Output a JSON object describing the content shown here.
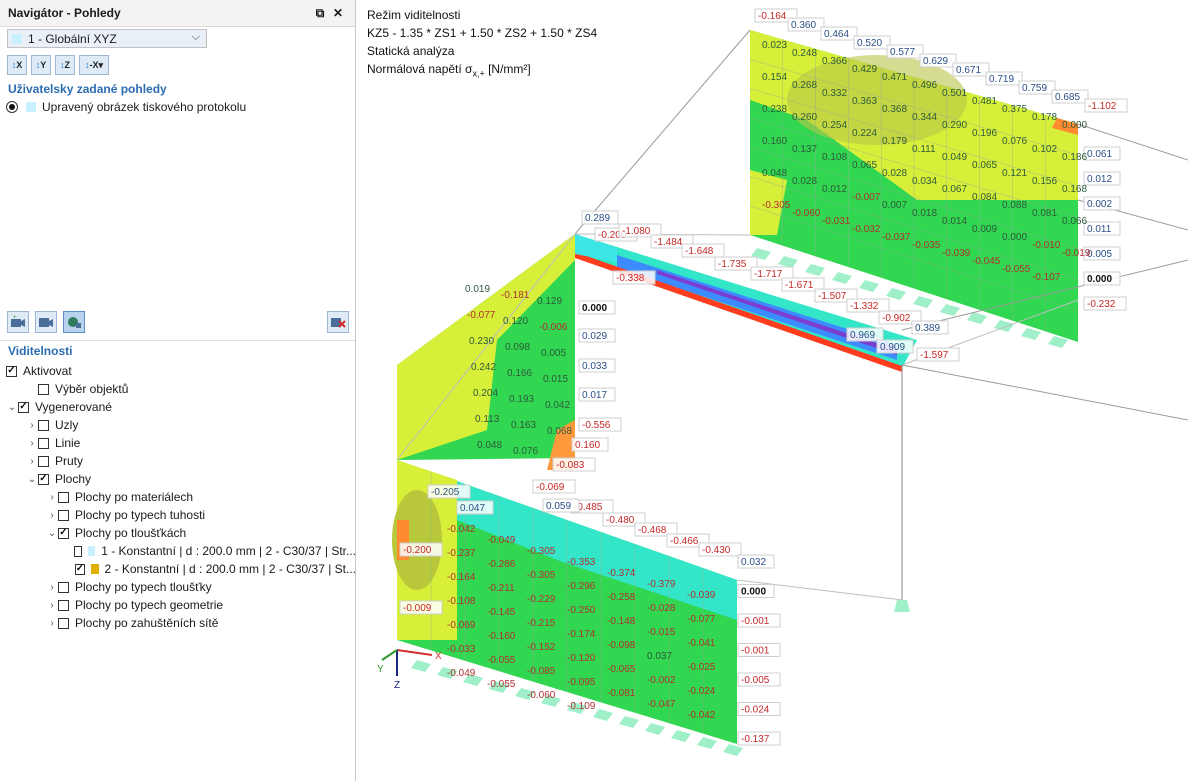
{
  "navigator": {
    "title": "Navigátor - Pohledy",
    "restore_icon": "⧉",
    "close_icon": "✕",
    "view_select": {
      "value": "1 - Globální XYZ",
      "swatch_color": "#c8f0ff"
    },
    "toolbar": [
      {
        "name": "view-x-button",
        "label": "X"
      },
      {
        "name": "view-y-button",
        "label": "Y"
      },
      {
        "name": "view-z-button",
        "label": "Z"
      },
      {
        "name": "view-minus-x-button",
        "label": "-X"
      }
    ],
    "user_views_header": "Uživatelsky zadané pohledy",
    "user_view_item": "Upravený obrázek tiskového protokolu",
    "visibility_header": "Viditelnosti",
    "tree": [
      {
        "level": 0,
        "expander": "",
        "checked": true,
        "label": "Aktivovat"
      },
      {
        "level": 1,
        "expander": "",
        "checked": false,
        "label": "Výběr objektů"
      },
      {
        "level": 0,
        "expander": "down",
        "checked": true,
        "label": "Vygenerované"
      },
      {
        "level": 1,
        "expander": "right",
        "checked": false,
        "label": "Uzly"
      },
      {
        "level": 1,
        "expander": "right",
        "checked": false,
        "label": "Linie"
      },
      {
        "level": 1,
        "expander": "right",
        "checked": false,
        "label": "Pruty"
      },
      {
        "level": 1,
        "expander": "down",
        "checked": true,
        "label": "Plochy"
      },
      {
        "level": 2,
        "expander": "right",
        "checked": false,
        "label": "Plochy po materiálech"
      },
      {
        "level": 2,
        "expander": "right",
        "checked": false,
        "label": "Plochy po typech tuhosti"
      },
      {
        "level": 2,
        "expander": "down",
        "checked": true,
        "label": "Plochy po tloušťkách"
      },
      {
        "level": 3,
        "expander": "",
        "checked": false,
        "swatch": "#c8f0ff",
        "label": "1 - Konstantní | d : 200.0 mm | 2 - C30/37 | Str..."
      },
      {
        "level": 3,
        "expander": "",
        "checked": true,
        "swatch": "#e0b000",
        "label": "2 - Konstantní | d : 200.0 mm | 2 - C30/37 | St..."
      },
      {
        "level": 2,
        "expander": "right",
        "checked": false,
        "label": "Plochy po typech tloušťky"
      },
      {
        "level": 2,
        "expander": "right",
        "checked": false,
        "label": "Plochy po typech geometrie"
      },
      {
        "level": 2,
        "expander": "right",
        "checked": false,
        "label": "Plochy po zahuštěních sítě"
      }
    ]
  },
  "viewport": {
    "line1": "Režim viditelnosti",
    "line2": "KZ5 - 1.35 * ZS1 + 1.50 * ZS2 + 1.50 * ZS4",
    "line3": "Statická analýza",
    "line4_prefix": "Normálová napětí σ",
    "line4_sub": "x,+",
    "line4_suffix": " [N/mm²]",
    "axes": {
      "x": "X",
      "y": "Y",
      "z": "Z"
    },
    "colors": {
      "positive_text": "#2a4f86",
      "negative_text": "#c62828",
      "green": "#31d651",
      "yellow": "#d8ef3a",
      "cyan": "#33e6c8"
    },
    "top_panel_labels": [
      {
        "v": "-0.164",
        "neg": true
      },
      {
        "v": "0.360"
      },
      {
        "v": "0.464"
      },
      {
        "v": "0.520"
      },
      {
        "v": "0.577"
      },
      {
        "v": "0.629"
      },
      {
        "v": "0.671"
      },
      {
        "v": "0.719"
      },
      {
        "v": "0.759"
      },
      {
        "v": "0.685"
      },
      {
        "v": "-1.102",
        "neg": true
      }
    ],
    "top_panel_right": [
      {
        "v": "0.061"
      },
      {
        "v": "0.012"
      },
      {
        "v": "0.002"
      },
      {
        "v": "0.011"
      },
      {
        "v": "0.005"
      },
      {
        "v": "0.000",
        "bold": true
      },
      {
        "v": "-0.232",
        "neg": true
      }
    ],
    "top_panel_inner": [
      "0.023",
      "0.248",
      "0.366",
      "0.429",
      "0.471",
      "0.496",
      "0.501",
      "0.481",
      "0.375",
      "0.178",
      "0.000",
      "0.154",
      "0.268",
      "0.332",
      "0.363",
      "0.368",
      "0.344",
      "0.290",
      "0.196",
      "0.076",
      "0.102",
      "0.186",
      "0.238",
      "0.260",
      "0.254",
      "0.224",
      "0.179",
      "0.111",
      "0.049",
      "0.065",
      "0.121",
      "0.156",
      "0.168",
      "0.160",
      "0.137",
      "0.108",
      "0.065",
      "0.028",
      "0.034",
      "0.067",
      "0.084",
      "0.088",
      "0.081",
      "0.066",
      "0.048",
      "0.028",
      "0.012",
      "-0.007",
      "0.007",
      "0.018",
      "0.014",
      "0.009",
      "0.000",
      "-0.010",
      "-0.019",
      "-0.305",
      "-0.060",
      "-0.031",
      "-0.032",
      "-0.037",
      "-0.035",
      "-0.039",
      "-0.045",
      "-0.055",
      "-0.107"
    ],
    "beam_labels": [
      {
        "v": "0.289"
      },
      {
        "v": "-0.200",
        "neg": true
      },
      {
        "v": "-1.080",
        "neg": true
      },
      {
        "v": "-1.484",
        "neg": true
      },
      {
        "v": "-1.648",
        "neg": true
      },
      {
        "v": "-1.735",
        "neg": true
      },
      {
        "v": "-1.717",
        "neg": true
      },
      {
        "v": "-1.671",
        "neg": true
      },
      {
        "v": "-1.507",
        "neg": true
      },
      {
        "v": "-1.332",
        "neg": true
      },
      {
        "v": "-0.902",
        "neg": true
      },
      {
        "v": "0.389"
      },
      {
        "v": "-1.597",
        "neg": true
      },
      {
        "v": "-0.338",
        "neg": true
      },
      {
        "v": "0.969"
      },
      {
        "v": "0.909"
      }
    ],
    "mid_panel_right": [
      {
        "v": "0.000",
        "bold": true
      },
      {
        "v": "0.029"
      },
      {
        "v": "0.033"
      },
      {
        "v": "0.017"
      },
      {
        "v": "-0.556",
        "neg": true
      },
      {
        "v": "0.160",
        "neg": true
      },
      {
        "v": "-0.083",
        "neg": true
      },
      {
        "v": "-0.069",
        "neg": true
      }
    ],
    "mid_panel_inner": [
      "0.019",
      "-0.181",
      "0.129",
      "-0.077",
      "0.120",
      "-0.006",
      "0.230",
      "0.098",
      "0.005",
      "0.242",
      "0.166",
      "0.015",
      "0.204",
      "0.193",
      "0.042",
      "0.113",
      "0.163",
      "0.068",
      "0.048",
      "0.076"
    ],
    "bottom_panel_top": [
      {
        "v": "-0.485",
        "neg": true
      },
      {
        "v": "-0.480",
        "neg": true
      },
      {
        "v": "-0.468",
        "neg": true
      },
      {
        "v": "-0.466",
        "neg": true
      },
      {
        "v": "-0.430",
        "neg": true
      },
      {
        "v": "0.059"
      },
      {
        "v": "-0.205"
      },
      {
        "v": "0.047"
      }
    ],
    "bottom_panel_right": [
      {
        "v": "0.032"
      },
      {
        "v": "0.000",
        "bold": true
      },
      {
        "v": "-0.001",
        "neg": true
      },
      {
        "v": "-0.001",
        "neg": true
      },
      {
        "v": "-0.005",
        "neg": true
      },
      {
        "v": "-0.024",
        "neg": true
      },
      {
        "v": "-0.137",
        "neg": true
      }
    ],
    "bottom_panel_left": [
      {
        "v": "-0.200",
        "neg": true
      },
      {
        "v": "-0.009",
        "neg": true
      }
    ],
    "bottom_panel_inner": [
      "-0.042",
      "-0.049",
      "-0.305",
      "-0.353",
      "-0.374",
      "-0.379",
      "-0.039",
      "-0.237",
      "-0.286",
      "-0.305",
      "-0.296",
      "-0.258",
      "-0.028",
      "-0.077",
      "-0.164",
      "-0.211",
      "-0.229",
      "-0.250",
      "-0.148",
      "-0.015",
      "-0.041",
      "-0.108",
      "-0.145",
      "-0.215",
      "-0.174",
      "-0.098",
      "0.037",
      "-0.025",
      "-0.069",
      "-0.160",
      "-0.152",
      "-0.120",
      "-0.065",
      "-0.002",
      "-0.024",
      "-0.033",
      "-0.055",
      "-0.085",
      "-0.095",
      "-0.081",
      "-0.047",
      "-0.042",
      "-0.049",
      "-0.055",
      "-0.060",
      "-0.109"
    ]
  }
}
